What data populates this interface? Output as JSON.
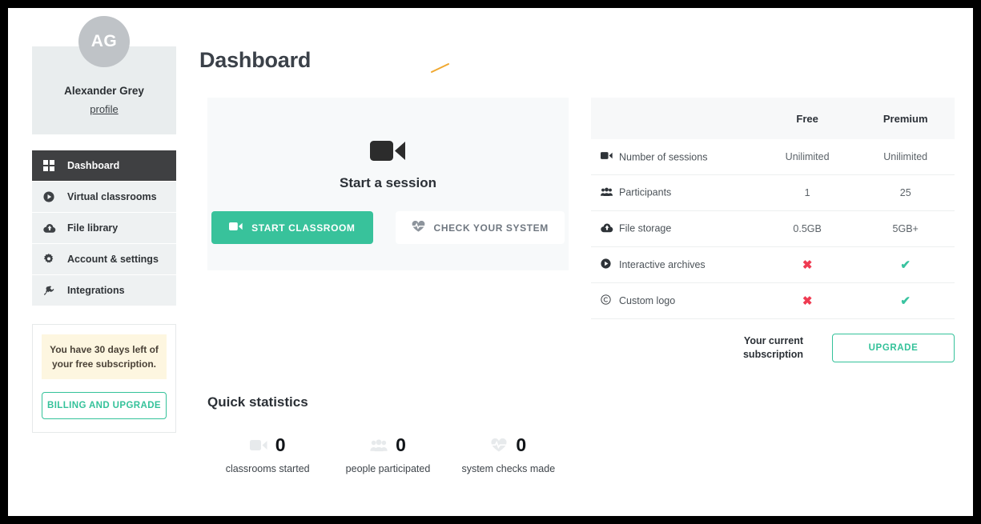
{
  "sidebar": {
    "profile": {
      "initials": "AG",
      "name": "Alexander Grey",
      "link_label": "profile"
    },
    "nav": [
      {
        "label": "Dashboard",
        "icon": "grid-icon",
        "active": true
      },
      {
        "label": "Virtual classrooms",
        "icon": "play-circle-icon",
        "active": false
      },
      {
        "label": "File library",
        "icon": "cloud-upload-icon",
        "active": false
      },
      {
        "label": "Account & settings",
        "icon": "gear-icon",
        "active": false
      },
      {
        "label": "Integrations",
        "icon": "plug-icon",
        "active": false
      }
    ],
    "billing": {
      "note": "You have 30 days left of your free subscription.",
      "button_label": "BILLING AND UPGRADE"
    }
  },
  "main": {
    "title": "Dashboard",
    "session": {
      "icon": "video-camera-icon",
      "heading": "Start a session",
      "start_button": "START CLASSROOM",
      "start_button_icon": "video-camera-icon",
      "check_button": "CHECK YOUR SYSTEM",
      "check_button_icon": "heartbeat-icon"
    },
    "plans": {
      "columns": [
        "",
        "Free",
        "Premium"
      ],
      "rows": [
        {
          "feature": "Number of sessions",
          "icon": "video-camera-icon",
          "free": "Unilimited",
          "premium": "Unilimited",
          "type": "text"
        },
        {
          "feature": "Participants",
          "icon": "users-icon",
          "free": "1",
          "premium": "25",
          "type": "text"
        },
        {
          "feature": "File storage",
          "icon": "cloud-upload-icon",
          "free": "0.5GB",
          "premium": "5GB+",
          "type": "text"
        },
        {
          "feature": "Interactive archives",
          "icon": "play-circle-icon",
          "free": "✖",
          "premium": "✔",
          "type": "mark"
        },
        {
          "feature": "Custom logo",
          "icon": "copyright-icon",
          "free": "✖",
          "premium": "✔",
          "type": "mark"
        }
      ],
      "subscription_label": "Your current subscription",
      "upgrade_button": "UPGRADE"
    },
    "stats": {
      "title": "Quick statistics",
      "items": [
        {
          "value": "0",
          "label": "classrooms started",
          "icon": "video-camera-icon"
        },
        {
          "value": "0",
          "label": "people participated",
          "icon": "users-icon"
        },
        {
          "value": "0",
          "label": "system checks made",
          "icon": "heartbeat-icon"
        }
      ]
    }
  },
  "colors": {
    "accent": "#34c29a",
    "active_nav": "#3f4042",
    "no_mark": "#ef3b52",
    "yes_mark": "#39c3a0",
    "note_bg": "#fdf6e0",
    "annotation": "#f0a830"
  }
}
